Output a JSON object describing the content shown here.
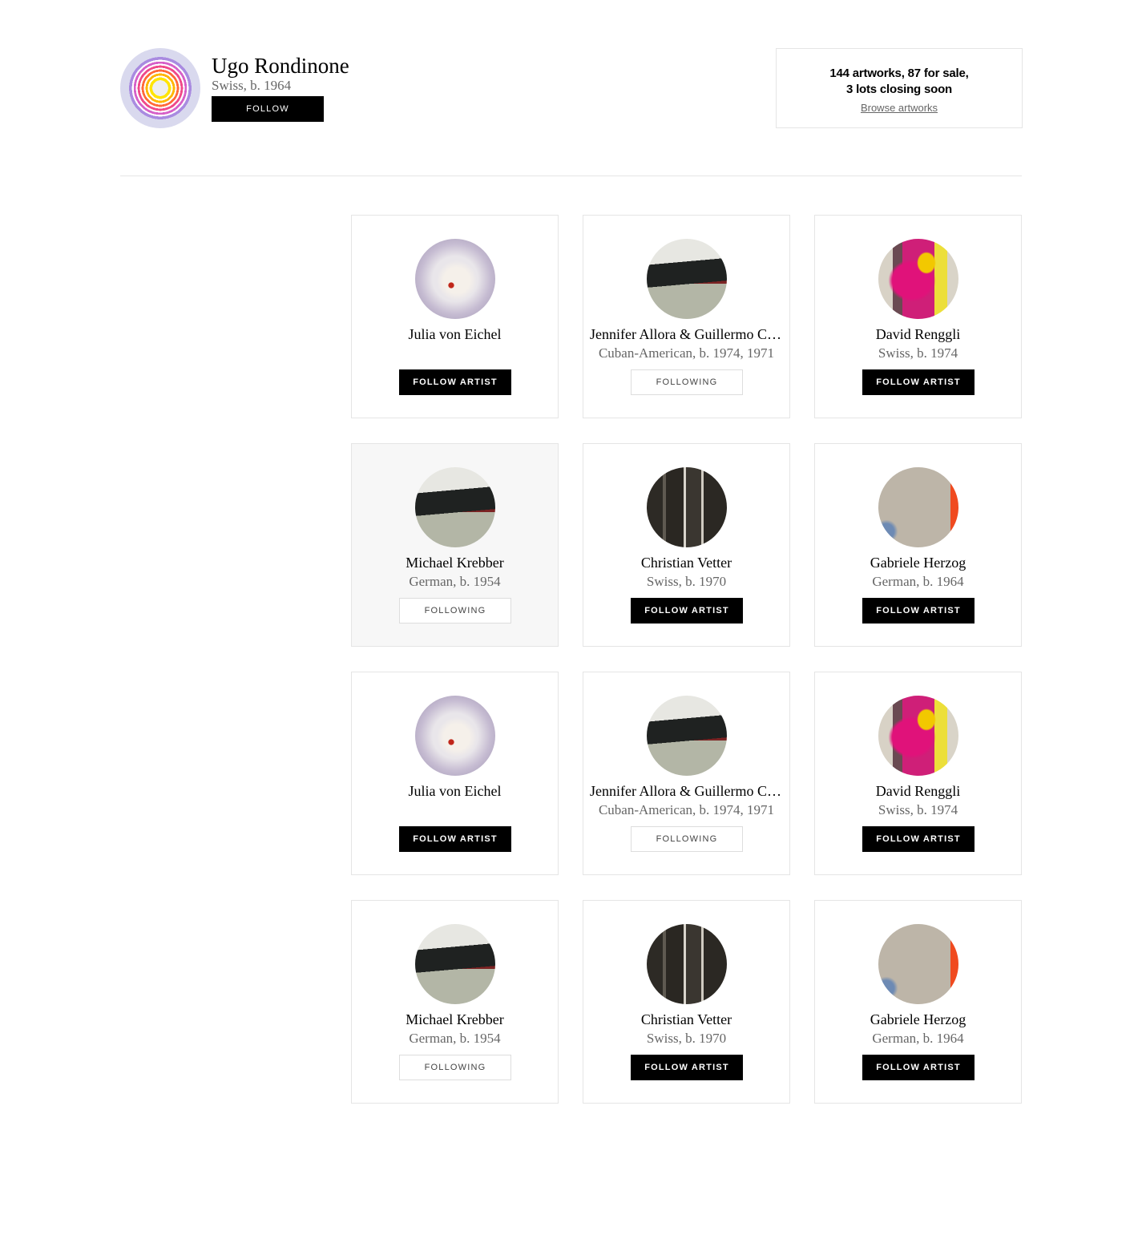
{
  "artist": {
    "name": "Ugo Rondinone",
    "meta": "Swiss, b. 1964",
    "follow_label": "FOLLOW"
  },
  "stats": {
    "line1": "144 artworks, 87 for sale,",
    "line2": "3 lots closing soon",
    "link": "Browse artworks"
  },
  "related_artists": [
    {
      "name": "Julia von Eichel",
      "meta": "",
      "button": "FOLLOW ARTIST",
      "following": false,
      "image": "glass-sphere"
    },
    {
      "name": "Jennifer Allora & Guillermo Calzadilla",
      "meta": "Cuban-American, b. 1974, 1971",
      "button": "FOLLOWING",
      "following": true,
      "image": "ship-landscape"
    },
    {
      "name": "David Renggli",
      "meta": "Swiss, b. 1974",
      "button": "FOLLOW ARTIST",
      "following": false,
      "image": "pink-yellow-painting"
    },
    {
      "name": "Michael Krebber",
      "meta": "German, b. 1954",
      "button": "FOLLOWING",
      "following": true,
      "image": "ship-landscape"
    },
    {
      "name": "Christian Vetter",
      "meta": "Swiss, b. 1970",
      "button": "FOLLOW ARTIST",
      "following": false,
      "image": "dark-abstract"
    },
    {
      "name": "Gabriele Herzog",
      "meta": "German, b. 1964",
      "button": "FOLLOW ARTIST",
      "following": false,
      "image": "grey-painting"
    },
    {
      "name": "Julia von Eichel",
      "meta": "",
      "button": "FOLLOW ARTIST",
      "following": false,
      "image": "glass-sphere"
    },
    {
      "name": "Jennifer Allora & Guillermo Calzadilla",
      "meta": "Cuban-American, b. 1974, 1971",
      "button": "FOLLOWING",
      "following": true,
      "image": "ship-landscape"
    },
    {
      "name": "David Renggli",
      "meta": "Swiss, b. 1974",
      "button": "FOLLOW ARTIST",
      "following": false,
      "image": "pink-yellow-painting"
    },
    {
      "name": "Michael Krebber",
      "meta": "German, b. 1954",
      "button": "FOLLOWING",
      "following": true,
      "image": "ship-landscape"
    },
    {
      "name": "Christian Vetter",
      "meta": "Swiss, b. 1970",
      "button": "FOLLOW ARTIST",
      "following": false,
      "image": "dark-abstract"
    },
    {
      "name": "Gabriele Herzog",
      "meta": "German, b. 1964",
      "button": "FOLLOW ARTIST",
      "following": false,
      "image": "grey-painting"
    }
  ]
}
